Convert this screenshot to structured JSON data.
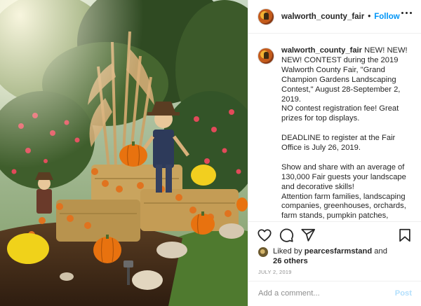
{
  "account": {
    "username": "walworth_county_fair",
    "follow_label": "Follow",
    "separator": "•"
  },
  "caption": {
    "username": "walworth_county_fair",
    "lines": [
      "NEW! NEW! NEW! CONTEST during the 2019 Walworth County Fair, \"Grand Champion Gardens Landscaping Contest,\" August 28-September 2, 2019.",
      "NO contest registration fee! Great prizes for top displays.",
      "",
      "DEADLINE to register at the Fair Office is July 26, 2019.",
      "",
      "Show and share with an average of 130,000 Fair guests your landscape and decorative skills!",
      "Attention farm families, landscaping companies, greenhouses, orchards, farm stands, pumpkin patches, metalworks, home improvement"
    ]
  },
  "likes": {
    "prefix": "Liked by",
    "user": "pearcesfarmstand",
    "conjunction": "and",
    "others": "26 others"
  },
  "date": "July 2, 2019",
  "comment": {
    "placeholder": "Add a comment...",
    "post_label": "Post"
  },
  "icons": {
    "like": "heart-icon",
    "comment": "comment-bubble-icon",
    "share": "paper-plane-icon",
    "save": "bookmark-icon",
    "more": "more-dots-icon"
  },
  "colors": {
    "follow": "#0095f6",
    "post_disabled": "#b2dffc",
    "secondary_text": "#8e8e8e",
    "divider": "#efefef"
  }
}
